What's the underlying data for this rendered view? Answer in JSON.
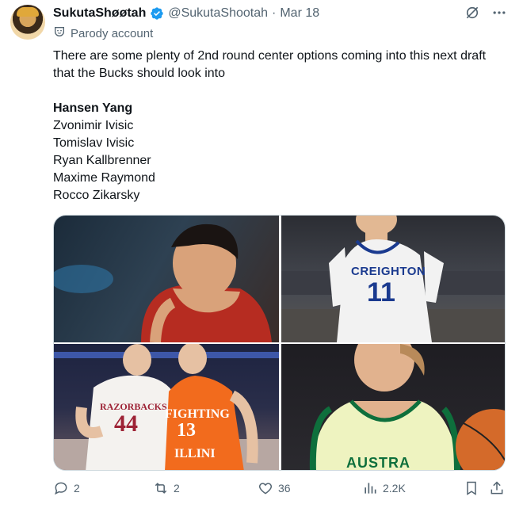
{
  "author": {
    "display_name": "SukutaShøøtah",
    "handle": "@SukutaShootah",
    "separator": "·",
    "date": "Mar 18",
    "label": "Parody account"
  },
  "tweet": {
    "text": "There are some plenty of 2nd round center options coming into this next draft that the Bucks should look into",
    "names": [
      "Hansen Yang",
      "Zvonimir Ivisic",
      "Tomislav Ivisic",
      "Ryan Kallbrenner",
      "Maxime Raymond",
      "Rocco Zikarsky"
    ]
  },
  "media": {
    "jersey_2": {
      "team": "CREIGHTON",
      "number": "11"
    },
    "jersey_3a": {
      "team": "RAZORBACKS",
      "number": "44"
    },
    "jersey_3b": {
      "team": "FIGHTING",
      "number": "13",
      "bottom": "ILLINI"
    },
    "jersey_4": {
      "team": "AUSTRA"
    }
  },
  "actions": {
    "replies": "2",
    "reposts": "2",
    "likes": "36",
    "views": "2.2K"
  },
  "colors": {
    "verified": "#1d9bf0",
    "muted": "#536471",
    "text": "#0f1419"
  },
  "icons": [
    "verified-badge-icon",
    "grok-icon",
    "more-icon",
    "parody-mask-icon",
    "reply-icon",
    "repost-icon",
    "like-icon",
    "views-icon",
    "bookmark-icon",
    "share-icon"
  ]
}
